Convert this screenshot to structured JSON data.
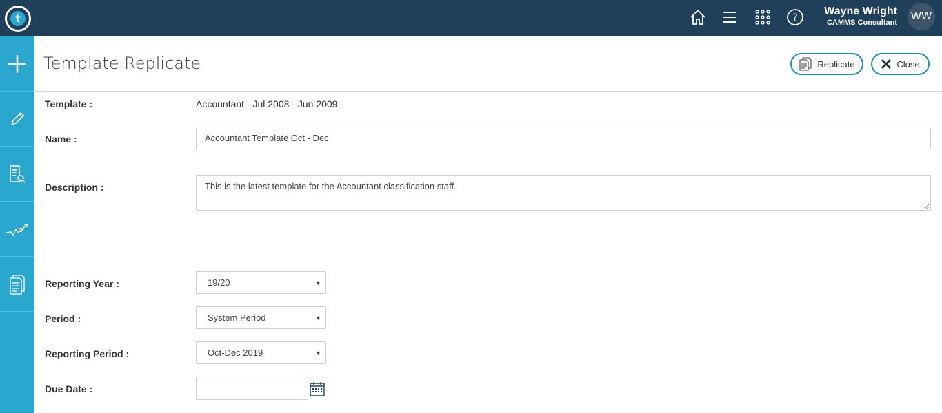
{
  "header": {
    "user_name": "Wayne Wright",
    "user_role": "CAMMS Consultant",
    "avatar_initials": "WW",
    "logo_letter": "t"
  },
  "icons": {
    "top": [
      "home-icon",
      "menu-icon",
      "apps-grid-icon",
      "help-icon"
    ],
    "sidebar": [
      "add-icon",
      "edit-icon",
      "document-search-icon",
      "trend-icon",
      "documents-icon"
    ]
  },
  "page": {
    "title": "Template Replicate",
    "replicate_label": "Replicate",
    "close_label": "Close"
  },
  "form": {
    "template_label": "Template :",
    "template_value": "Accountant - Jul 2008 - Jun 2009",
    "name_label": "Name :",
    "name_value": "Accountant Template  Oct - Dec",
    "description_label": "Description :",
    "description_value": "This is the latest template for the Accountant classification staff.",
    "reporting_year_label": "Reporting Year :",
    "reporting_year_value": "19/20",
    "period_label": "Period :",
    "period_value": "System Period",
    "reporting_period_label": "Reporting Period :",
    "reporting_period_value": "Oct-Dec 2019",
    "due_date_label": "Due Date :",
    "due_date_value": ""
  },
  "colors": {
    "topbar": "#1f3f5b",
    "sidebar": "#2ba7cf",
    "button_border": "#1f8fa8"
  }
}
